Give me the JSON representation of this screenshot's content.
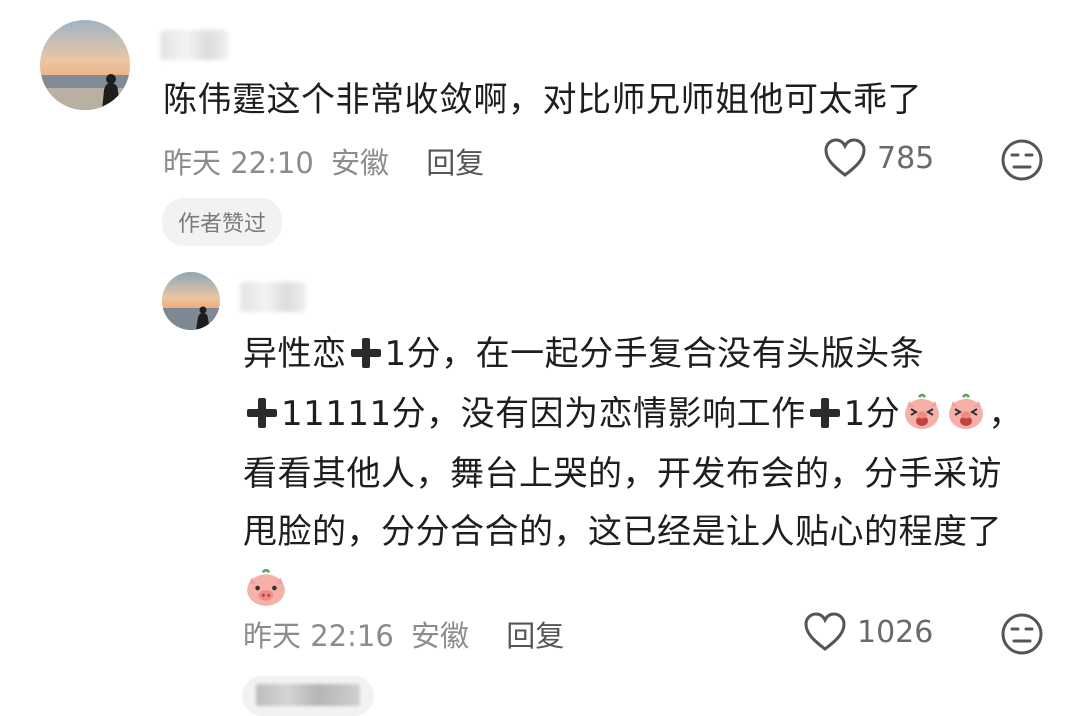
{
  "comments": [
    {
      "text": "陈伟霆这个非常收敛啊，对比师兄师姐他可太乖了",
      "time": "昨天 22:10",
      "location": "安徽",
      "reply_label": "回复",
      "likes": "785",
      "author_badge": "作者赞过"
    }
  ],
  "reply": {
    "line1_a": "异性恋",
    "line1_b": "1分，在一起分手复合没有头版头条",
    "line2_a": "11111分，没有因为恋情影响工作",
    "line2_b": "1分",
    "line2_c": "，",
    "line3": "看看其他人，舞台上哭的，开发布会的，分手采访",
    "line4": "甩脸的，分分合合的，这已经是让人贴心的程度了",
    "time": "昨天 22:16",
    "location": "安徽",
    "reply_label": "回复",
    "likes": "1026"
  },
  "icons": {
    "like": "heart-outline-icon",
    "dislike": "neutral-face-icon",
    "plus": "heavy-plus-icon",
    "emoji_laugh": "pig-laughing-emoji",
    "emoji_pig": "pig-face-emoji"
  },
  "colors": {
    "meta": "#8c8c8c",
    "badge_bg": "#f2f2f2",
    "pig": "#f5a7a4"
  }
}
